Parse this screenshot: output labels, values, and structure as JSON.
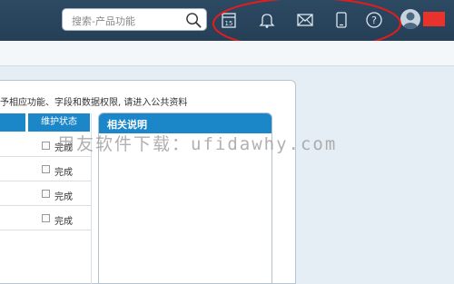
{
  "search": {
    "placeholder": "搜索-产品功能"
  },
  "top_icons": [
    {
      "name": "calendar-icon",
      "label": "15"
    },
    {
      "name": "bell-icon"
    },
    {
      "name": "mail-icon"
    },
    {
      "name": "mobile-icon"
    },
    {
      "name": "help-icon",
      "label": "?"
    }
  ],
  "notice": {
    "text": "予相应功能、字段和数据权限, 请进入公共资料"
  },
  "table": {
    "status_header": "维护状态",
    "rows": [
      {
        "status": "完成"
      },
      {
        "status": "完成"
      },
      {
        "status": "完成"
      },
      {
        "status": "完成"
      }
    ]
  },
  "panel": {
    "title": "相关说明"
  },
  "watermark": {
    "text": "用友软件下载：ufidawhy.com"
  },
  "colors": {
    "topbar": "#2d4a63",
    "accent_blue": "#1b86c8",
    "annotation_red": "#e11d1d",
    "user_badge": "#e8322b"
  }
}
